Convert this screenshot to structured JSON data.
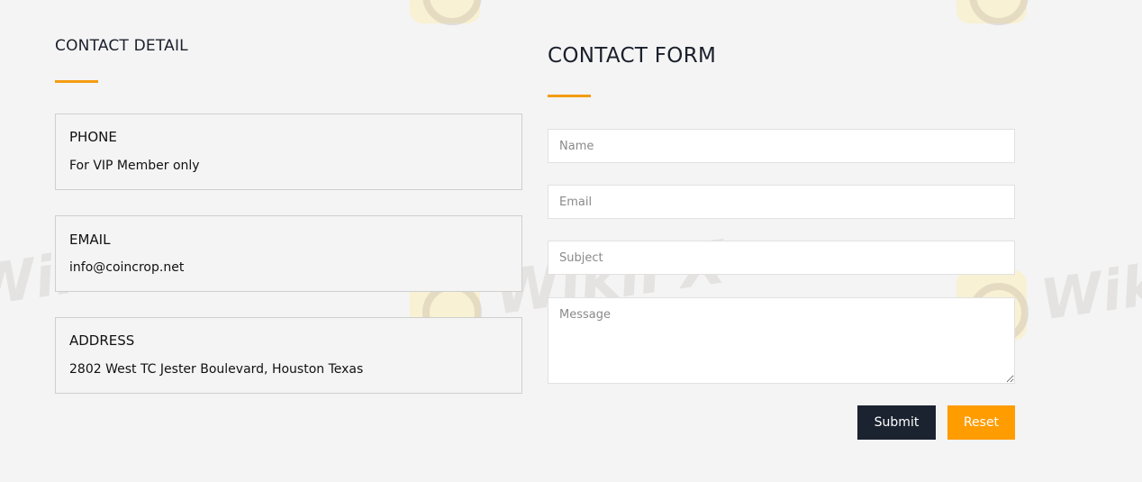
{
  "theme": {
    "accent_color": "#f39c12",
    "submit_color": "#1b2230",
    "reset_color": "#ff9c00",
    "background": "#f4f4f4"
  },
  "contact_detail": {
    "heading": "CONTACT DETAIL",
    "cards": [
      {
        "label": "PHONE",
        "value": "For VIP Member only"
      },
      {
        "label": "EMAIL",
        "value": "info@coincrop.net"
      },
      {
        "label": "ADDRESS",
        "value": "2802 West TC Jester Boulevard, Houston Texas"
      }
    ]
  },
  "contact_form": {
    "heading": "CONTACT FORM",
    "fields": {
      "name": {
        "placeholder": "Name",
        "value": ""
      },
      "email": {
        "placeholder": "Email",
        "value": ""
      },
      "subject": {
        "placeholder": "Subject",
        "value": ""
      },
      "message": {
        "placeholder": "Message",
        "value": ""
      }
    },
    "submit_label": "Submit",
    "reset_label": "Reset"
  },
  "watermark": {
    "text": "WikiFX",
    "icon": "wikifx-logo-icon"
  }
}
